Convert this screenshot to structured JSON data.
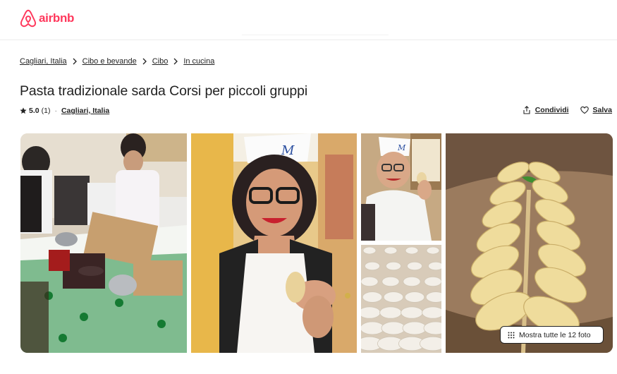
{
  "header": {
    "logo_text": "airbnb",
    "logo_icon": "airbnb-logo-icon",
    "brand_color": "#ff385c"
  },
  "breadcrumb": {
    "items": [
      "Cagliari, Italia",
      "Cibo e bevande",
      "Cibo",
      "In cucina"
    ],
    "separator_icon": "chevron-right-icon"
  },
  "listing": {
    "title": "Pasta tradizionale sarda Corsi per piccoli gruppi",
    "rating": "5.0",
    "reviews": "(1)",
    "separator": "·",
    "location": "Cagliari, Italia",
    "star_icon": "star-icon"
  },
  "actions": {
    "share_label": "Condividi",
    "share_icon": "share-icon",
    "save_label": "Salva",
    "save_icon": "heart-icon"
  },
  "gallery": {
    "photos": [
      "photo-pasta-class-table",
      "photo-host-smiling",
      "photo-host-in-chef-hat",
      "photo-ravioli-rows",
      "photo-culurgiones-leaf-arrangement"
    ],
    "show_all_label": "Mostra tutte le 12 foto",
    "show_all_icon": "grid-dots-icon"
  }
}
